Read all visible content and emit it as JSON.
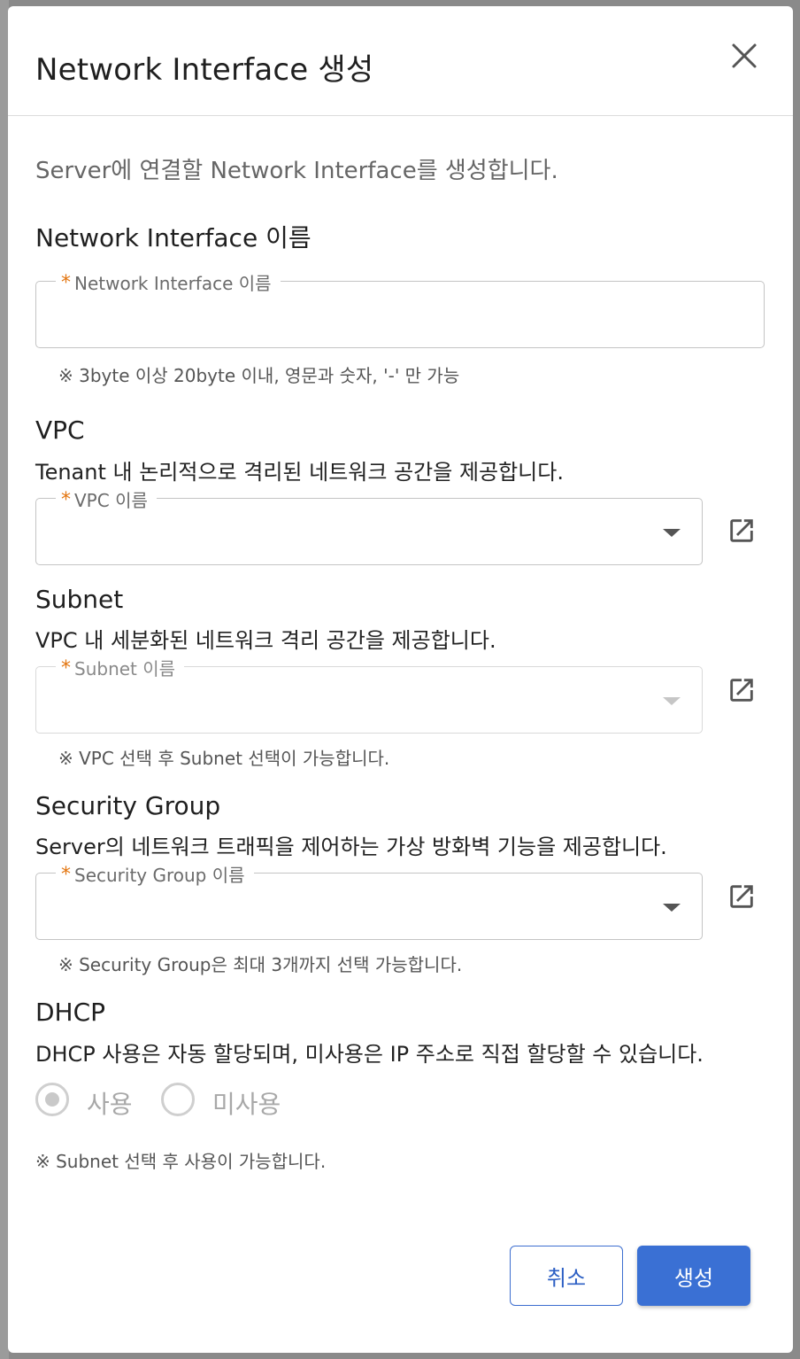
{
  "dialog": {
    "title": "Network Interface 생성",
    "description": "Server에 연결할 Network Interface를 생성합니다."
  },
  "name_section": {
    "title": "Network Interface 이름",
    "field_label": "Network Interface 이름",
    "required_mark": "*",
    "value": "",
    "hint": "※ 3byte 이상 20byte 이내, 영문과 숫자, '-' 만 가능"
  },
  "vpc_section": {
    "title": "VPC",
    "description": "Tenant 내 논리적으로 격리된 네트워크 공간을 제공합니다.",
    "field_label": "VPC 이름",
    "required_mark": "*",
    "value": ""
  },
  "subnet_section": {
    "title": "Subnet",
    "description": "VPC 내 세분화된 네트워크 격리 공간을 제공합니다.",
    "field_label": "Subnet 이름",
    "required_mark": "*",
    "value": "",
    "hint": "※ VPC 선택 후 Subnet 선택이 가능합니다."
  },
  "security_group_section": {
    "title": "Security Group",
    "description": "Server의 네트워크 트래픽을 제어하는 가상 방화벽 기능을 제공합니다.",
    "field_label": "Security Group 이름",
    "required_mark": "*",
    "value": "",
    "hint": "※ Security Group은 최대 3개까지 선택 가능합니다."
  },
  "dhcp_section": {
    "title": "DHCP",
    "description": "DHCP 사용은 자동 할당되며, 미사용은 IP 주소로 직접 할당할 수 있습니다.",
    "options": [
      {
        "label": "사용",
        "checked": true
      },
      {
        "label": "미사용",
        "checked": false
      }
    ],
    "hint": "※ Subnet 선택 후 사용이 가능합니다."
  },
  "actions": {
    "cancel_label": "취소",
    "create_label": "생성"
  },
  "icons": {
    "close": "close-icon",
    "external_link": "open-in-new-icon",
    "dropdown": "caret-down-icon"
  },
  "colors": {
    "primary": "#3a70d4",
    "required": "#e3750f",
    "backdrop": "#8a8a8a"
  }
}
